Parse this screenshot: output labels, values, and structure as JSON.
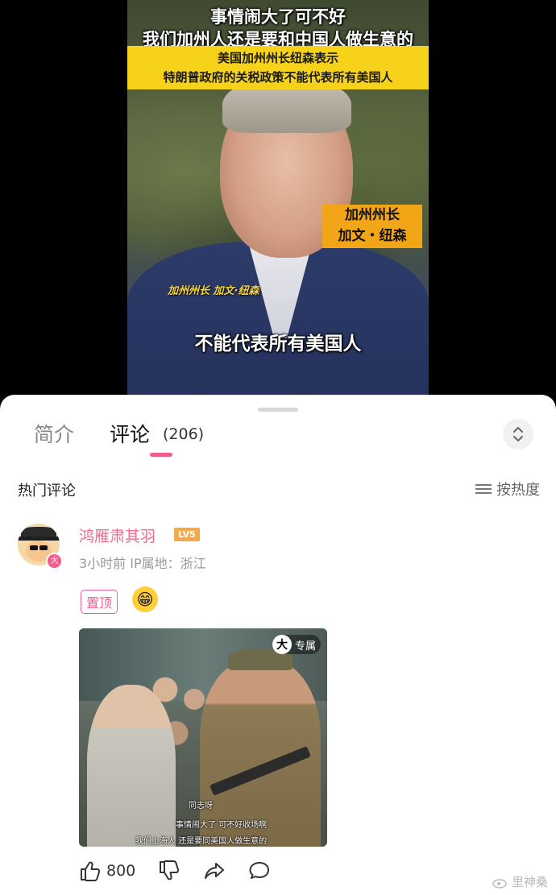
{
  "video": {
    "title_line1": "事情闹大了可不好",
    "title_line2": "我们加州人还是要和中国人做生意的",
    "banner_line1": "美国加州州长纽森表示",
    "banner_line2": "特朗普政府的关税政策不能代表所有美国人",
    "name_box_line1": "加州州长",
    "name_box_line2": "加文・纽森",
    "name_caption": "加州州长 加文·纽森",
    "subtitle": "不能代表所有美国人"
  },
  "tabs": {
    "intro": "简介",
    "comments": "评论",
    "comments_count": "(206)"
  },
  "section": {
    "hot_label": "热门评论",
    "sort_label": "按热度"
  },
  "comment": {
    "username": "鸿雁肃其羽",
    "level": "LV5",
    "avatar_badge": "大",
    "meta": "3小时前 IP属地：浙江",
    "pin_label": "置顶",
    "image_badge_icon": "大",
    "image_badge_text": "专属",
    "image_caption1": "同志呀",
    "image_caption2": "事情闹大了 可不好收场啊",
    "image_caption3": "我们上海人 还是要同美国人做生意的",
    "likes": "800"
  },
  "watermark": "里神桑",
  "colors": {
    "accent_pink": "#f25d8e",
    "banner_yellow": "#f6d21a",
    "namebox_orange": "#f3a518"
  },
  "icons": [
    "chevron-updown-icon",
    "sort-lines-icon",
    "thumb-up-icon",
    "thumb-down-icon",
    "share-icon",
    "reply-bubble-icon",
    "weibo-icon"
  ]
}
